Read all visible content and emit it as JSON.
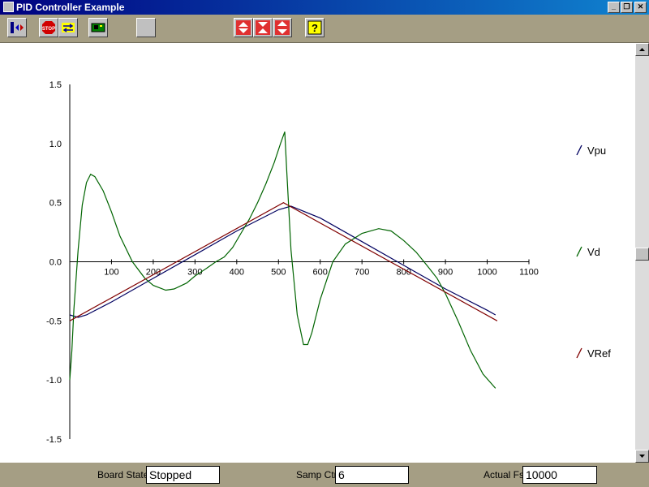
{
  "window": {
    "title": "PID Controller Example",
    "minimize": "_",
    "restore": "❐",
    "close": "✕"
  },
  "toolbar": {
    "icons": [
      "connect-icon",
      "stop-icon",
      "swap-icon",
      "board-icon",
      "blank-icon",
      "zoom-in-icon",
      "zoom-fit-icon",
      "zoom-out-icon",
      "help-icon"
    ]
  },
  "chart_data": {
    "type": "line",
    "xlim": [
      0,
      1100
    ],
    "ylim": [
      -1.5,
      1.5
    ],
    "x_ticks": [
      "100",
      "200",
      "300",
      "400",
      "500",
      "600",
      "700",
      "800",
      "900",
      "1000",
      "1100"
    ],
    "y_ticks": [
      "1.5",
      "1.0",
      "0.5",
      "0.0",
      "-0.5",
      "-1.0",
      "-1.5"
    ],
    "grid": false,
    "legend_position": "right",
    "series": [
      {
        "name": "Vpu",
        "color": "#000060",
        "x": [
          0,
          20,
          40,
          100,
          200,
          300,
          400,
          500,
          530,
          600,
          700,
          800,
          900,
          1000,
          1020
        ],
        "y": [
          -0.45,
          -0.47,
          -0.45,
          -0.34,
          -0.14,
          0.06,
          0.26,
          0.44,
          0.47,
          0.37,
          0.17,
          -0.03,
          -0.23,
          -0.41,
          -0.45
        ]
      },
      {
        "name": "Vd",
        "color": "#006400",
        "x": [
          0,
          5,
          10,
          20,
          30,
          40,
          50,
          60,
          80,
          100,
          120,
          150,
          180,
          200,
          230,
          250,
          280,
          300,
          330,
          350,
          370,
          390,
          410,
          430,
          450,
          470,
          490,
          505,
          515,
          520,
          530,
          545,
          560,
          570,
          580,
          600,
          630,
          660,
          700,
          740,
          770,
          800,
          830,
          860,
          880,
          900,
          930,
          960,
          990,
          1020
        ],
        "y": [
          -1.0,
          -0.75,
          -0.4,
          0.1,
          0.48,
          0.67,
          0.74,
          0.72,
          0.6,
          0.42,
          0.22,
          0.0,
          -0.14,
          -0.2,
          -0.24,
          -0.23,
          -0.18,
          -0.12,
          -0.05,
          0.0,
          0.04,
          0.12,
          0.24,
          0.36,
          0.5,
          0.66,
          0.84,
          1.0,
          1.1,
          0.75,
          0.1,
          -0.45,
          -0.7,
          -0.7,
          -0.6,
          -0.32,
          0.0,
          0.15,
          0.24,
          0.28,
          0.26,
          0.18,
          0.08,
          -0.05,
          -0.14,
          -0.27,
          -0.5,
          -0.75,
          -0.95,
          -1.07
        ]
      },
      {
        "name": "VRef",
        "color": "#800000",
        "x": [
          0,
          512,
          1024
        ],
        "y": [
          -0.5,
          0.5,
          -0.5
        ]
      }
    ]
  },
  "status": {
    "board_state_label": "Board State",
    "board_state_value": "Stopped",
    "samp_ctr_label": "Samp Ctr",
    "samp_ctr_value": "6",
    "actual_fs_label": "Actual Fs",
    "actual_fs_value": "10000"
  }
}
